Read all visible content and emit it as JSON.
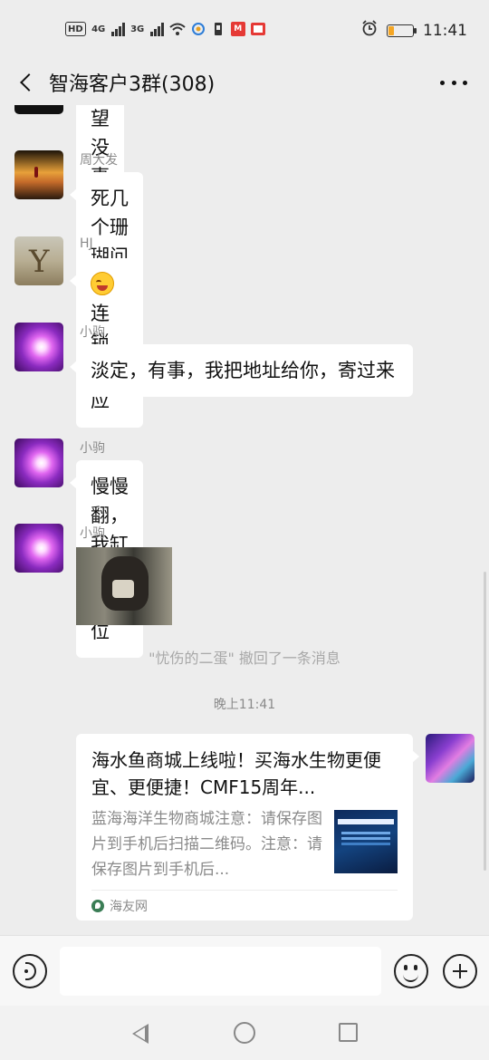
{
  "status_bar": {
    "hd": "HD",
    "net1": "4G",
    "net2": "3G",
    "red_icon": "M",
    "battery_level": 0.22,
    "time": "11:41"
  },
  "title_bar": {
    "title": "智海客户3群(308)"
  },
  "messages": [
    {
      "sender": "",
      "text": "希望没事"
    },
    {
      "sender": "周大发",
      "text": "死几个珊瑚问题不大，别让我翻缸"
    },
    {
      "sender": "HJ",
      "text": "连锁反应"
    },
    {
      "sender": "小驹",
      "text": "淡定，有事，我把地址给你，寄过来"
    },
    {
      "sender": "小驹",
      "text": "慢慢翻，我缸里还有吉位"
    },
    {
      "sender": "小驹",
      "text": ""
    }
  ],
  "system_notice": "\"忧伤的二蛋\" 撤回了一条消息",
  "timestamp": "晚上11:41",
  "link_card": {
    "title": "海水鱼商城上线啦！买海水生物更便宜、更便捷！CMF15周年...",
    "description": "蓝海海洋生物商城注意：请保存图片到手机后扫描二维码。注意：请保存图片到手机后...",
    "source": "海友网"
  },
  "input": {
    "placeholder": ""
  },
  "colors": {
    "background": "#ededed",
    "bubble": "#ffffff",
    "battery": "#f5a623"
  }
}
